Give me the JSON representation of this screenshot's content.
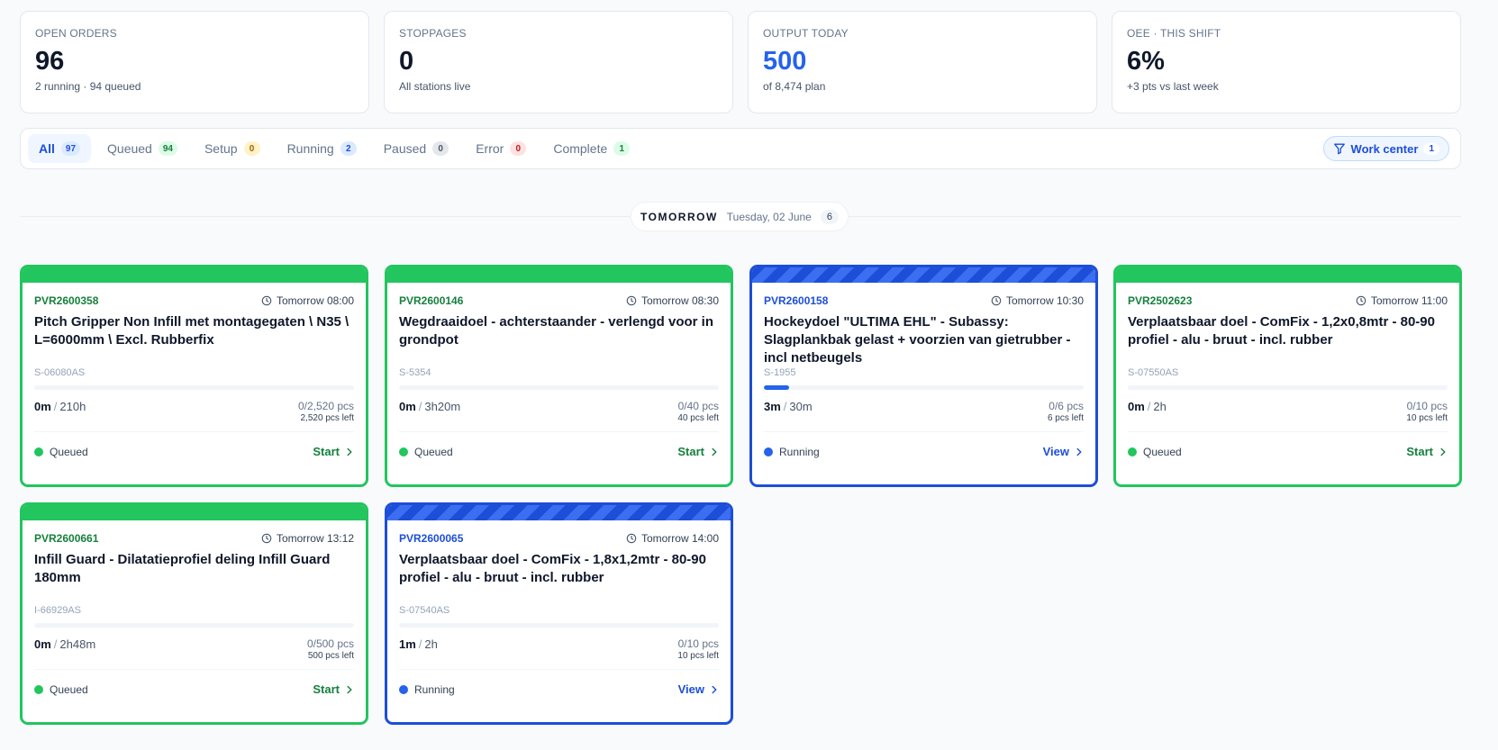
{
  "kpis": [
    {
      "label": "OPEN ORDERS",
      "value": "96",
      "sub": "2 running · 94 queued"
    },
    {
      "label": "STOPPAGES",
      "value": "0",
      "sub": "All stations live"
    },
    {
      "label": "OUTPUT TODAY",
      "value": "500",
      "sub": "of 8,474 plan"
    },
    {
      "label": "OEE · THIS SHIFT",
      "value": "6%",
      "sub": "+3 pts vs last week"
    }
  ],
  "filters": [
    {
      "label": "All",
      "count": "97"
    },
    {
      "label": "Queued",
      "count": "94"
    },
    {
      "label": "Setup",
      "count": "0"
    },
    {
      "label": "Running",
      "count": "2"
    },
    {
      "label": "Paused",
      "count": "0"
    },
    {
      "label": "Error",
      "count": "0"
    },
    {
      "label": "Complete",
      "count": "1"
    }
  ],
  "work_center": {
    "label": "Work center",
    "count": "1"
  },
  "date_group": {
    "label": "TOMORROW",
    "date": "Tuesday, 02 June",
    "count": "6"
  },
  "cards": [
    {
      "code": "PVR2600358",
      "time": "Tomorrow 08:00",
      "title": "Pitch Gripper Non Infill met montagegaten \\ N35 \\ L=6000mm \\ Excl. Rubberfix",
      "sku": "S-06080AS",
      "elapsed": "0m",
      "planned": "210h",
      "pcs": "0/2,520 pcs",
      "left": "2,520 pcs left",
      "progress": 0,
      "status": "Queued",
      "action": "Start"
    },
    {
      "code": "PVR2600146",
      "time": "Tomorrow 08:30",
      "title": "Wegdraaidoel - achterstaander - verlengd voor in grondpot",
      "sku": "S-5354",
      "elapsed": "0m",
      "planned": "3h20m",
      "pcs": "0/40 pcs",
      "left": "40 pcs left",
      "progress": 0,
      "status": "Queued",
      "action": "Start"
    },
    {
      "code": "PVR2600158",
      "time": "Tomorrow 10:30",
      "title": "Hockeydoel \"ULTIMA EHL\" - Subassy: Slagplankbak gelast + voorzien van gietrubber - incl netbeugels",
      "sku": "S-1955",
      "elapsed": "3m",
      "planned": "30m",
      "pcs": "0/6 pcs",
      "left": "6 pcs left",
      "progress": 0.08,
      "status": "Running",
      "action": "View"
    },
    {
      "code": "PVR2502623",
      "time": "Tomorrow 11:00",
      "title": "Verplaatsbaar doel - ComFix - 1,2x0,8mtr - 80-90 profiel - alu - bruut - incl. rubber",
      "sku": "S-07550AS",
      "elapsed": "0m",
      "planned": "2h",
      "pcs": "0/10 pcs",
      "left": "10 pcs left",
      "progress": 0,
      "status": "Queued",
      "action": "Start"
    },
    {
      "code": "PVR2600661",
      "time": "Tomorrow 13:12",
      "title": "Infill Guard - Dilatatieprofiel deling Infill Guard 180mm",
      "sku": "I-66929AS",
      "elapsed": "0m",
      "planned": "2h48m",
      "pcs": "0/500 pcs",
      "left": "500 pcs left",
      "progress": 0,
      "status": "Queued",
      "action": "Start"
    },
    {
      "code": "PVR2600065",
      "time": "Tomorrow 14:00",
      "title": "Verplaatsbaar doel - ComFix - 1,8x1,2mtr - 80-90 profiel - alu - bruut - incl. rubber",
      "sku": "S-07540AS",
      "elapsed": "1m",
      "planned": "2h",
      "pcs": "0/10 pcs",
      "left": "10 pcs left",
      "progress": 0,
      "status": "Running",
      "action": "View"
    }
  ]
}
